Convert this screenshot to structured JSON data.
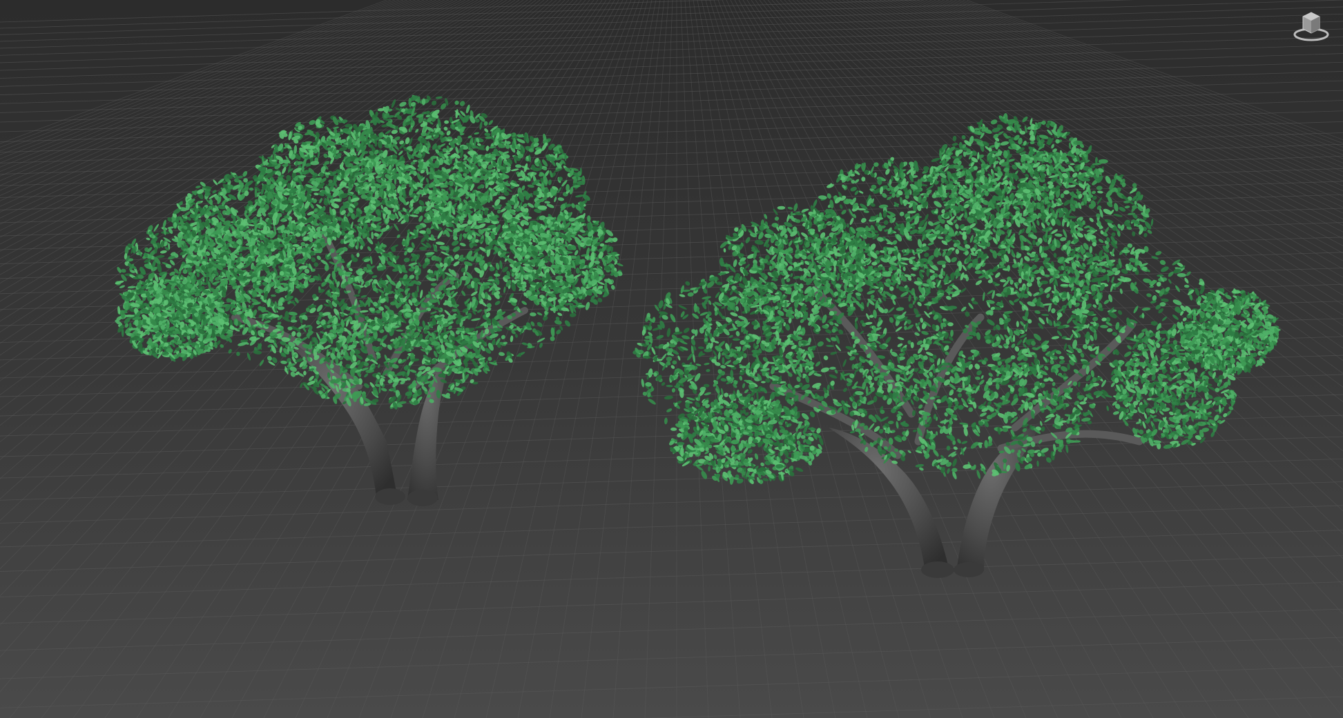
{
  "viewport": {
    "background_top": "#2e2e2e",
    "background_bottom": "#4a4a4a",
    "grid_color": "#5c5c5c"
  },
  "scene": {
    "objects": [
      {
        "name": "tree-left",
        "foliage_color": "#3e9a55",
        "bark_color": "#4d4d4d"
      },
      {
        "name": "tree-right",
        "foliage_color": "#3e9a55",
        "bark_color": "#4d4d4d"
      }
    ]
  },
  "viewcube": {
    "icon": "viewcube-icon"
  }
}
